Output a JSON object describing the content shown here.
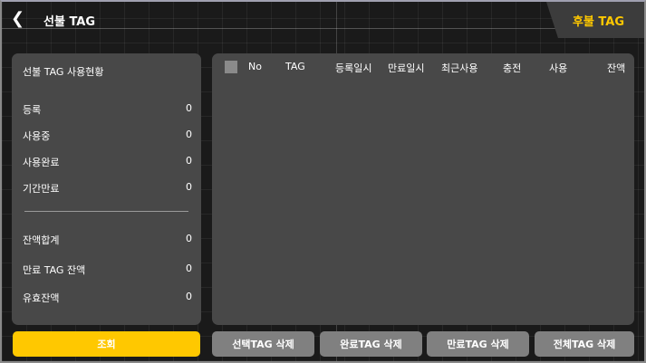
{
  "header": {
    "title": "선불 TAG",
    "tab_label": "후불 TAG"
  },
  "summary": {
    "title": "선불 TAG 사용현황",
    "rows": [
      {
        "label": "등록",
        "value": "0"
      },
      {
        "label": "사용중",
        "value": "0"
      },
      {
        "label": "사용완료",
        "value": "0"
      },
      {
        "label": "기간만료",
        "value": "0"
      }
    ],
    "balance_rows": [
      {
        "label": "잔액합계",
        "value": "0"
      },
      {
        "label": "만료 TAG 잔액",
        "value": "0"
      },
      {
        "label": "유효잔액",
        "value": "0"
      }
    ]
  },
  "table": {
    "columns": [
      "No",
      "TAG",
      "등록일시",
      "만료일시",
      "최근사용",
      "충전",
      "사용",
      "잔액"
    ]
  },
  "buttons": {
    "query": "조회",
    "delete_selected": "선택TAG 삭제",
    "delete_completed": "완료TAG 삭제",
    "delete_expired": "만료TAG 삭제",
    "delete_all": "전체TAG 삭제"
  },
  "colors": {
    "accent": "#ffc800",
    "panel": "#484848",
    "button": "#808080"
  }
}
